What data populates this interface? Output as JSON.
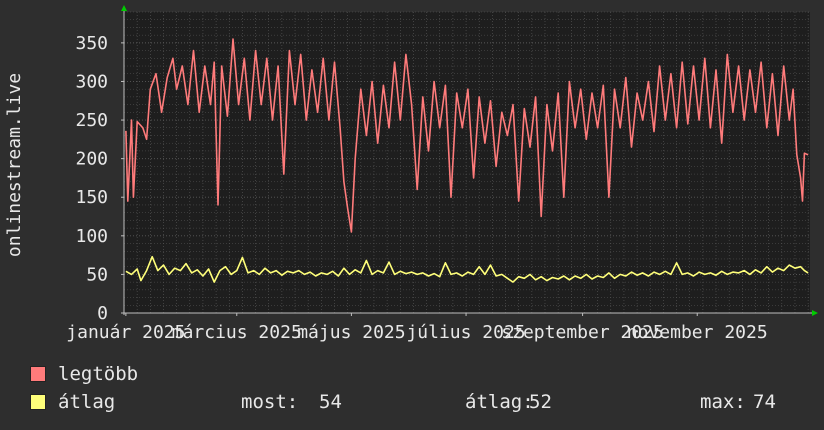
{
  "chart_data": {
    "type": "line",
    "ylabel": "onlinestream.live",
    "xlabel": "",
    "ylim": [
      0,
      390
    ],
    "yticks": [
      0,
      50,
      100,
      150,
      200,
      250,
      300,
      350
    ],
    "x_range": [
      "2024-12-31",
      "2025-12-31"
    ],
    "xticks": [
      {
        "date": "2025-01-01",
        "label": "január 2025"
      },
      {
        "date": "2025-03-01",
        "label": "március 2025"
      },
      {
        "date": "2025-05-01",
        "label": "május 2025"
      },
      {
        "date": "2025-07-01",
        "label": "július 2025"
      },
      {
        "date": "2025-09-01",
        "label": "szeptember 2025"
      },
      {
        "date": "2025-11-01",
        "label": "november 2025"
      }
    ],
    "grid": true,
    "legend_position": "bottom-left",
    "series": [
      {
        "name": "legtöbb",
        "color": "#ff7b7b",
        "points": [
          [
            "2025-01-01",
            236
          ],
          [
            "2025-01-02",
            145
          ],
          [
            "2025-01-04",
            250
          ],
          [
            "2025-01-05",
            150
          ],
          [
            "2025-01-07",
            248
          ],
          [
            "2025-01-10",
            240
          ],
          [
            "2025-01-12",
            225
          ],
          [
            "2025-01-14",
            290
          ],
          [
            "2025-01-17",
            310
          ],
          [
            "2025-01-20",
            260
          ],
          [
            "2025-01-23",
            305
          ],
          [
            "2025-01-26",
            330
          ],
          [
            "2025-01-28",
            290
          ],
          [
            "2025-01-31",
            320
          ],
          [
            "2025-02-03",
            270
          ],
          [
            "2025-02-06",
            340
          ],
          [
            "2025-02-09",
            260
          ],
          [
            "2025-02-12",
            320
          ],
          [
            "2025-02-15",
            270
          ],
          [
            "2025-02-17",
            325
          ],
          [
            "2025-02-19",
            140
          ],
          [
            "2025-02-21",
            320
          ],
          [
            "2025-02-24",
            255
          ],
          [
            "2025-02-27",
            355
          ],
          [
            "2025-03-02",
            270
          ],
          [
            "2025-03-05",
            330
          ],
          [
            "2025-03-08",
            250
          ],
          [
            "2025-03-11",
            340
          ],
          [
            "2025-03-14",
            270
          ],
          [
            "2025-03-17",
            330
          ],
          [
            "2025-03-20",
            250
          ],
          [
            "2025-03-23",
            320
          ],
          [
            "2025-03-26",
            180
          ],
          [
            "2025-03-29",
            340
          ],
          [
            "2025-04-01",
            270
          ],
          [
            "2025-04-04",
            335
          ],
          [
            "2025-04-07",
            250
          ],
          [
            "2025-04-10",
            315
          ],
          [
            "2025-04-13",
            260
          ],
          [
            "2025-04-16",
            330
          ],
          [
            "2025-04-19",
            250
          ],
          [
            "2025-04-22",
            325
          ],
          [
            "2025-04-25",
            240
          ],
          [
            "2025-04-27",
            170
          ],
          [
            "2025-04-29",
            135
          ],
          [
            "2025-05-01",
            105
          ],
          [
            "2025-05-03",
            200
          ],
          [
            "2025-05-06",
            290
          ],
          [
            "2025-05-09",
            230
          ],
          [
            "2025-05-12",
            300
          ],
          [
            "2025-05-15",
            220
          ],
          [
            "2025-05-18",
            295
          ],
          [
            "2025-05-21",
            240
          ],
          [
            "2025-05-24",
            325
          ],
          [
            "2025-05-27",
            250
          ],
          [
            "2025-05-30",
            335
          ],
          [
            "2025-06-02",
            270
          ],
          [
            "2025-06-05",
            160
          ],
          [
            "2025-06-08",
            280
          ],
          [
            "2025-06-11",
            210
          ],
          [
            "2025-06-14",
            300
          ],
          [
            "2025-06-17",
            240
          ],
          [
            "2025-06-20",
            295
          ],
          [
            "2025-06-23",
            150
          ],
          [
            "2025-06-26",
            285
          ],
          [
            "2025-06-29",
            240
          ],
          [
            "2025-07-02",
            290
          ],
          [
            "2025-07-05",
            175
          ],
          [
            "2025-07-08",
            280
          ],
          [
            "2025-07-11",
            220
          ],
          [
            "2025-07-14",
            275
          ],
          [
            "2025-07-17",
            190
          ],
          [
            "2025-07-20",
            260
          ],
          [
            "2025-07-23",
            230
          ],
          [
            "2025-07-26",
            270
          ],
          [
            "2025-07-29",
            145
          ],
          [
            "2025-08-01",
            265
          ],
          [
            "2025-08-04",
            215
          ],
          [
            "2025-08-07",
            280
          ],
          [
            "2025-08-10",
            125
          ],
          [
            "2025-08-13",
            270
          ],
          [
            "2025-08-16",
            210
          ],
          [
            "2025-08-19",
            285
          ],
          [
            "2025-08-22",
            150
          ],
          [
            "2025-08-25",
            300
          ],
          [
            "2025-08-28",
            240
          ],
          [
            "2025-08-31",
            290
          ],
          [
            "2025-09-03",
            225
          ],
          [
            "2025-09-06",
            285
          ],
          [
            "2025-09-09",
            240
          ],
          [
            "2025-09-12",
            295
          ],
          [
            "2025-09-15",
            150
          ],
          [
            "2025-09-18",
            290
          ],
          [
            "2025-09-21",
            240
          ],
          [
            "2025-09-24",
            305
          ],
          [
            "2025-09-27",
            215
          ],
          [
            "2025-09-30",
            285
          ],
          [
            "2025-10-03",
            250
          ],
          [
            "2025-10-06",
            300
          ],
          [
            "2025-10-09",
            235
          ],
          [
            "2025-10-12",
            320
          ],
          [
            "2025-10-15",
            250
          ],
          [
            "2025-10-18",
            310
          ],
          [
            "2025-10-21",
            240
          ],
          [
            "2025-10-24",
            325
          ],
          [
            "2025-10-27",
            245
          ],
          [
            "2025-10-30",
            320
          ],
          [
            "2025-11-02",
            250
          ],
          [
            "2025-11-05",
            330
          ],
          [
            "2025-11-08",
            240
          ],
          [
            "2025-11-11",
            315
          ],
          [
            "2025-11-14",
            220
          ],
          [
            "2025-11-17",
            335
          ],
          [
            "2025-11-20",
            260
          ],
          [
            "2025-11-23",
            320
          ],
          [
            "2025-11-26",
            250
          ],
          [
            "2025-11-29",
            315
          ],
          [
            "2025-12-02",
            260
          ],
          [
            "2025-12-05",
            325
          ],
          [
            "2025-12-08",
            240
          ],
          [
            "2025-12-11",
            310
          ],
          [
            "2025-12-14",
            230
          ],
          [
            "2025-12-17",
            320
          ],
          [
            "2025-12-20",
            250
          ],
          [
            "2025-12-22",
            290
          ],
          [
            "2025-12-24",
            205
          ],
          [
            "2025-12-26",
            175
          ],
          [
            "2025-12-27",
            145
          ],
          [
            "2025-12-28",
            207
          ],
          [
            "2025-12-30",
            205
          ]
        ]
      },
      {
        "name": "átlag",
        "color": "#ffff7a",
        "points": [
          [
            "2025-01-01",
            54
          ],
          [
            "2025-01-04",
            50
          ],
          [
            "2025-01-07",
            57
          ],
          [
            "2025-01-09",
            42
          ],
          [
            "2025-01-12",
            55
          ],
          [
            "2025-01-15",
            73
          ],
          [
            "2025-01-18",
            55
          ],
          [
            "2025-01-21",
            62
          ],
          [
            "2025-01-24",
            50
          ],
          [
            "2025-01-27",
            58
          ],
          [
            "2025-01-30",
            55
          ],
          [
            "2025-02-02",
            64
          ],
          [
            "2025-02-05",
            52
          ],
          [
            "2025-02-08",
            56
          ],
          [
            "2025-02-11",
            48
          ],
          [
            "2025-02-14",
            57
          ],
          [
            "2025-02-17",
            40
          ],
          [
            "2025-02-20",
            55
          ],
          [
            "2025-02-23",
            60
          ],
          [
            "2025-02-26",
            50
          ],
          [
            "2025-03-01",
            55
          ],
          [
            "2025-03-04",
            72
          ],
          [
            "2025-03-07",
            52
          ],
          [
            "2025-03-10",
            55
          ],
          [
            "2025-03-13",
            50
          ],
          [
            "2025-03-16",
            58
          ],
          [
            "2025-03-19",
            52
          ],
          [
            "2025-03-22",
            55
          ],
          [
            "2025-03-25",
            49
          ],
          [
            "2025-03-28",
            54
          ],
          [
            "2025-03-31",
            52
          ],
          [
            "2025-04-03",
            55
          ],
          [
            "2025-04-06",
            50
          ],
          [
            "2025-04-09",
            53
          ],
          [
            "2025-04-12",
            48
          ],
          [
            "2025-04-15",
            52
          ],
          [
            "2025-04-18",
            50
          ],
          [
            "2025-04-21",
            54
          ],
          [
            "2025-04-24",
            48
          ],
          [
            "2025-04-27",
            58
          ],
          [
            "2025-04-30",
            50
          ],
          [
            "2025-05-03",
            56
          ],
          [
            "2025-05-06",
            52
          ],
          [
            "2025-05-09",
            68
          ],
          [
            "2025-05-12",
            50
          ],
          [
            "2025-05-15",
            55
          ],
          [
            "2025-05-18",
            52
          ],
          [
            "2025-05-21",
            66
          ],
          [
            "2025-05-24",
            50
          ],
          [
            "2025-05-27",
            54
          ],
          [
            "2025-05-30",
            51
          ],
          [
            "2025-06-02",
            53
          ],
          [
            "2025-06-05",
            50
          ],
          [
            "2025-06-08",
            52
          ],
          [
            "2025-06-11",
            48
          ],
          [
            "2025-06-14",
            51
          ],
          [
            "2025-06-17",
            47
          ],
          [
            "2025-06-20",
            65
          ],
          [
            "2025-06-23",
            50
          ],
          [
            "2025-06-26",
            52
          ],
          [
            "2025-06-29",
            48
          ],
          [
            "2025-07-02",
            53
          ],
          [
            "2025-07-05",
            50
          ],
          [
            "2025-07-08",
            60
          ],
          [
            "2025-07-11",
            50
          ],
          [
            "2025-07-14",
            62
          ],
          [
            "2025-07-17",
            48
          ],
          [
            "2025-07-20",
            50
          ],
          [
            "2025-07-23",
            45
          ],
          [
            "2025-07-26",
            40
          ],
          [
            "2025-07-29",
            47
          ],
          [
            "2025-08-01",
            45
          ],
          [
            "2025-08-04",
            50
          ],
          [
            "2025-08-07",
            43
          ],
          [
            "2025-08-10",
            47
          ],
          [
            "2025-08-13",
            42
          ],
          [
            "2025-08-16",
            46
          ],
          [
            "2025-08-19",
            44
          ],
          [
            "2025-08-22",
            48
          ],
          [
            "2025-08-25",
            43
          ],
          [
            "2025-08-28",
            48
          ],
          [
            "2025-08-31",
            45
          ],
          [
            "2025-09-03",
            50
          ],
          [
            "2025-09-06",
            44
          ],
          [
            "2025-09-09",
            48
          ],
          [
            "2025-09-12",
            46
          ],
          [
            "2025-09-15",
            52
          ],
          [
            "2025-09-18",
            45
          ],
          [
            "2025-09-21",
            50
          ],
          [
            "2025-09-24",
            48
          ],
          [
            "2025-09-27",
            53
          ],
          [
            "2025-09-30",
            49
          ],
          [
            "2025-10-03",
            52
          ],
          [
            "2025-10-06",
            48
          ],
          [
            "2025-10-09",
            53
          ],
          [
            "2025-10-12",
            50
          ],
          [
            "2025-10-15",
            54
          ],
          [
            "2025-10-18",
            50
          ],
          [
            "2025-10-21",
            65
          ],
          [
            "2025-10-24",
            50
          ],
          [
            "2025-10-27",
            52
          ],
          [
            "2025-10-30",
            48
          ],
          [
            "2025-11-02",
            53
          ],
          [
            "2025-11-05",
            50
          ],
          [
            "2025-11-08",
            52
          ],
          [
            "2025-11-11",
            49
          ],
          [
            "2025-11-14",
            54
          ],
          [
            "2025-11-17",
            50
          ],
          [
            "2025-11-20",
            53
          ],
          [
            "2025-11-23",
            52
          ],
          [
            "2025-11-26",
            55
          ],
          [
            "2025-11-29",
            50
          ],
          [
            "2025-12-02",
            56
          ],
          [
            "2025-12-05",
            52
          ],
          [
            "2025-12-08",
            60
          ],
          [
            "2025-12-11",
            53
          ],
          [
            "2025-12-14",
            58
          ],
          [
            "2025-12-17",
            55
          ],
          [
            "2025-12-20",
            62
          ],
          [
            "2025-12-23",
            58
          ],
          [
            "2025-12-26",
            60
          ],
          [
            "2025-12-28",
            55
          ],
          [
            "2025-12-30",
            52
          ]
        ]
      }
    ]
  },
  "legend": {
    "items": [
      {
        "label": "legtöbb",
        "color": "#ff7b7b"
      },
      {
        "label": "átlag",
        "color": "#ffff7a"
      }
    ],
    "stats": {
      "most_label": "most:",
      "most_value": "54",
      "atlag_label": "átlag:",
      "atlag_value": "52",
      "max_label": "max:",
      "max_value": "74"
    }
  },
  "colors": {
    "background": "#2e2e2e",
    "plot_background": "#1e1e1e",
    "grid": "#5a5a5a",
    "axis_arrow": "#00cc00"
  }
}
